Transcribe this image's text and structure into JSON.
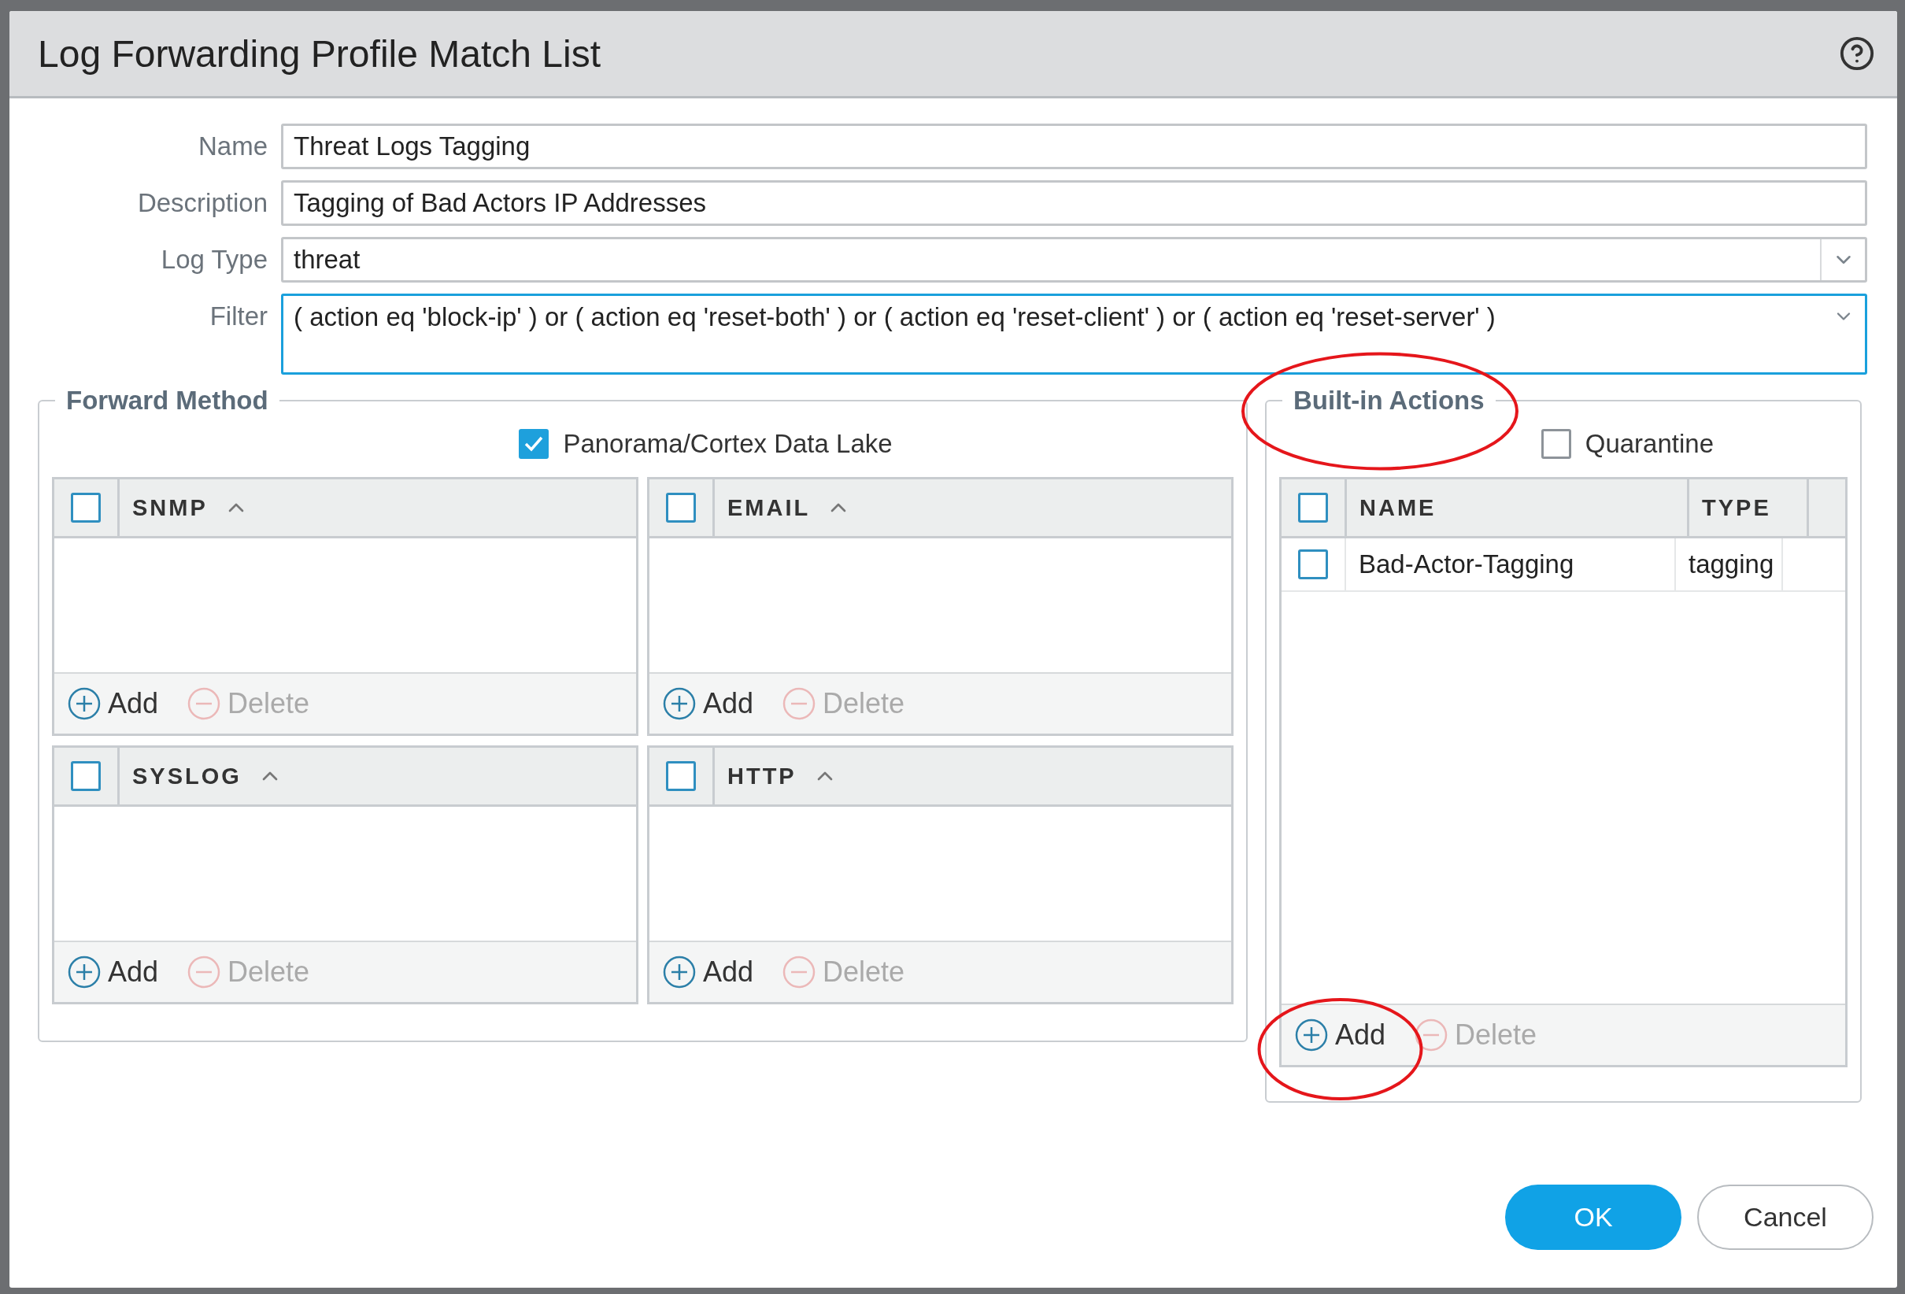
{
  "dialog": {
    "title": "Log Forwarding Profile Match List"
  },
  "fields": [
    {
      "label": "Name",
      "value": "Threat Logs Tagging",
      "kind": "text"
    },
    {
      "label": "Description",
      "value": "Tagging of Bad Actors IP Addresses",
      "kind": "text"
    },
    {
      "label": "Log Type",
      "value": "threat",
      "kind": "select"
    },
    {
      "label": "Filter",
      "value": "( action eq 'block-ip' ) or ( action eq 'reset-both' ) or ( action eq 'reset-client' ) or ( action eq 'reset-server' )",
      "kind": "filter"
    }
  ],
  "forward_method": {
    "title": "Forward Method",
    "panorama": {
      "label": "Panorama/Cortex Data Lake",
      "checked": true
    },
    "tables": [
      {
        "title": "SNMP",
        "checked": false,
        "actions": [
          {
            "label": "Add",
            "kind": "add",
            "disabled": false
          },
          {
            "label": "Delete",
            "kind": "delete",
            "disabled": true
          }
        ]
      },
      {
        "title": "EMAIL",
        "checked": false,
        "actions": [
          {
            "label": "Add",
            "kind": "add",
            "disabled": false
          },
          {
            "label": "Delete",
            "kind": "delete",
            "disabled": true
          }
        ]
      },
      {
        "title": "SYSLOG",
        "checked": false,
        "actions": [
          {
            "label": "Add",
            "kind": "add",
            "disabled": false
          },
          {
            "label": "Delete",
            "kind": "delete",
            "disabled": true
          }
        ]
      },
      {
        "title": "HTTP",
        "checked": false,
        "actions": [
          {
            "label": "Add",
            "kind": "add",
            "disabled": false
          },
          {
            "label": "Delete",
            "kind": "delete",
            "disabled": true
          }
        ]
      }
    ]
  },
  "builtin_actions": {
    "title": "Built-in Actions",
    "quarantine": {
      "label": "Quarantine",
      "checked": false
    },
    "header_checked": false,
    "columns": [
      "NAME",
      "TYPE"
    ],
    "rows": [
      {
        "name": "Bad-Actor-Tagging",
        "type": "tagging",
        "checked": false
      }
    ],
    "actions": [
      {
        "label": "Add",
        "kind": "add",
        "disabled": false
      },
      {
        "label": "Delete",
        "kind": "delete",
        "disabled": true
      }
    ]
  },
  "buttons": [
    {
      "label": "OK",
      "kind": "primary"
    },
    {
      "label": "Cancel",
      "kind": "secondary"
    }
  ]
}
